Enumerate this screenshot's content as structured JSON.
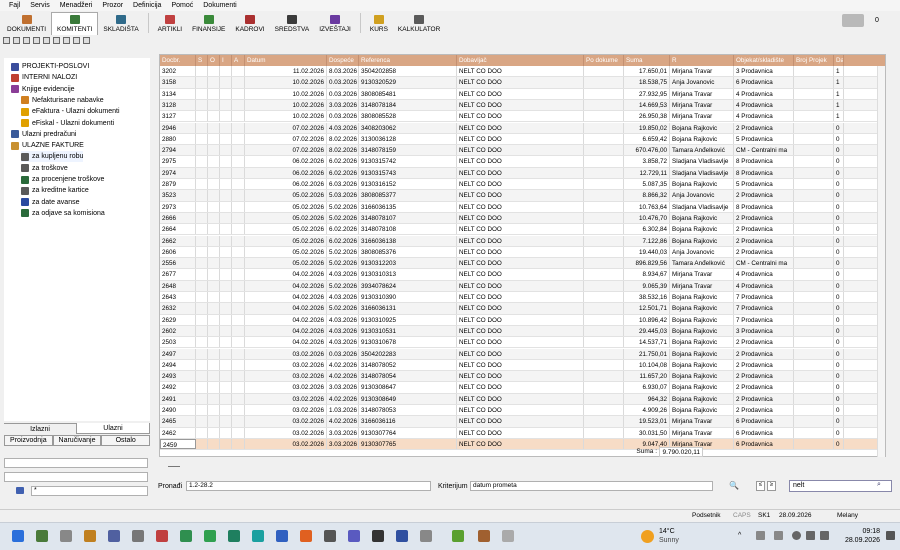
{
  "menu": [
    "Fajl",
    "Servis",
    "Menadžeri",
    "Prozor",
    "Definicija",
    "Pomoć",
    "Dokumenti"
  ],
  "toolbar": [
    "DOKUMENTI",
    "KOMITENTI",
    "SKLADIŠTA",
    "ARTIKLI",
    "FINANSIJE",
    "KADROVI",
    "SREDSTVA",
    "IZVEŠTAJI",
    "KURS",
    "KALKULATOR"
  ],
  "notification_count": "0",
  "tree": [
    {
      "label": "PROJEKTI-POSLOVI",
      "indent": 0,
      "icon": "projects-icon",
      "color": "#3a4d9c"
    },
    {
      "label": "INTERNI NALOZI",
      "indent": 0,
      "icon": "orders-icon",
      "color": "#c04030"
    },
    {
      "label": "Knjige evidencije",
      "indent": 0,
      "icon": "books-icon",
      "color": "#8a3d96"
    },
    {
      "label": "Nefakturisane nabavke",
      "indent": 1,
      "icon": "document-icon",
      "color": "#d08020"
    },
    {
      "label": "eFaktura - Ulazni dokumenti",
      "indent": 1,
      "icon": "efaktura-icon",
      "color": "#e0a000"
    },
    {
      "label": "eFiskal - Ulazni dokumenti",
      "indent": 1,
      "icon": "efiskal-icon",
      "color": "#e0a000"
    },
    {
      "label": "Ulazni predračuni",
      "indent": 0,
      "icon": "invoice-icon",
      "color": "#3a5a9a"
    },
    {
      "label": "ULAZNE FAKTURE",
      "indent": 0,
      "icon": "folder-icon",
      "color": "#c89030"
    },
    {
      "label": "za kupljenu robu",
      "indent": 1,
      "icon": "goods-icon",
      "color": "#5a5a5a"
    },
    {
      "label": "za troškove",
      "indent": 1,
      "icon": "costs-icon",
      "color": "#5a5a5a"
    },
    {
      "label": "za procenjene troškove",
      "indent": 1,
      "icon": "estimate-icon",
      "color": "#2a6a3a"
    },
    {
      "label": "za kreditne kartice",
      "indent": 1,
      "icon": "card-icon",
      "color": "#5a5a5a"
    },
    {
      "label": "za date avanse",
      "indent": 1,
      "icon": "advance-icon",
      "color": "#2a4aa0"
    },
    {
      "label": "za odjave sa komisiona",
      "indent": 1,
      "icon": "consign-icon",
      "color": "#2a6a3a"
    }
  ],
  "tabs_top": [
    "Izlazni",
    "Ulazni"
  ],
  "tabs_bottom": [
    "Proizvodnja",
    "Naručivanje",
    "Ostalo"
  ],
  "left_combo3_value": "*",
  "columns": [
    "Docbr.",
    "S",
    "O",
    "I",
    "A",
    "Datum",
    "Dospeće",
    "Referenca",
    "Dobavljač",
    "Po dokume",
    "Suma",
    "R",
    "Objekat/skladište",
    "Broj Projek",
    "Dat"
  ],
  "rows": [
    [
      "3202",
      "11.02.2026",
      "8.03.2026",
      "3504202858",
      "NELT CO DOO",
      "17.650,01",
      "Mirjana Travar",
      "3 Prodavnica",
      "1"
    ],
    [
      "3158",
      "10.02.2026",
      "0.03.2026",
      "9130320529",
      "NELT CO DOO",
      "18.538,75",
      "Anja Jovanovic",
      "6 Prodavnica",
      "1"
    ],
    [
      "3134",
      "10.02.2026",
      "0.03.2026",
      "3808085481",
      "NELT CO DOO",
      "27.932,95",
      "Mirjana Travar",
      "4 Prodavnica",
      "1"
    ],
    [
      "3128",
      "10.02.2026",
      "3.03.2026",
      "3148078184",
      "NELT CO DOO",
      "14.669,53",
      "Mirjana Travar",
      "4 Prodavnica",
      "1"
    ],
    [
      "3127",
      "10.02.2026",
      "0.03.2026",
      "3808085528",
      "NELT CO DOO",
      "26.950,38",
      "Mirjana Travar",
      "4 Prodavnica",
      "1"
    ],
    [
      "2946",
      "07.02.2026",
      "4.03.2026",
      "3408203062",
      "NELT CO DOO",
      "19.850,02",
      "Bojana Rajkovic",
      "2 Prodavnica",
      "0"
    ],
    [
      "2880",
      "07.02.2026",
      "8.02.2026",
      "3130036128",
      "NELT CO DOO",
      "6.659,42",
      "Bojana Rajkovic",
      "5 Prodavnica",
      "0"
    ],
    [
      "2794",
      "07.02.2026",
      "8.02.2026",
      "3148078159",
      "NELT CO DOO",
      "670.476,00",
      "Tamara Anđelković",
      "CM - Centralni ma",
      "0"
    ],
    [
      "2975",
      "06.02.2026",
      "6.02.2026",
      "9130315742",
      "NELT CO DOO",
      "3.858,72",
      "Sladjana Vladisavlje",
      "8 Prodavnica",
      "0"
    ],
    [
      "2974",
      "06.02.2026",
      "6.02.2026",
      "9130315743",
      "NELT CO DOO",
      "12.729,11",
      "Sladjana Vladisavlje",
      "8 Prodavnica",
      "0"
    ],
    [
      "2879",
      "06.02.2026",
      "6.03.2026",
      "9130316152",
      "NELT CO DOO",
      "5.087,35",
      "Bojana Rajkovic",
      "5 Prodavnica",
      "0"
    ],
    [
      "3523",
      "05.02.2026",
      "5.03.2026",
      "3808085377",
      "NELT CO DOO",
      "8.866,32",
      "Anja Jovanovic",
      "2 Prodavnica",
      "0"
    ],
    [
      "2973",
      "05.02.2026",
      "5.02.2026",
      "3166036135",
      "NELT CO DOO",
      "10.763,64",
      "Sladjana Vladisavlje",
      "8 Prodavnica",
      "0"
    ],
    [
      "2666",
      "05.02.2026",
      "5.02.2026",
      "3148078107",
      "NELT CO DOO",
      "10.476,70",
      "Bojana Rajkovic",
      "2 Prodavnica",
      "0"
    ],
    [
      "2664",
      "05.02.2026",
      "6.02.2026",
      "3148078108",
      "NELT CO DOO",
      "6.302,84",
      "Bojana Rajkovic",
      "2 Prodavnica",
      "0"
    ],
    [
      "2662",
      "05.02.2026",
      "6.02.2026",
      "3166036138",
      "NELT CO DOO",
      "7.122,86",
      "Bojana Rajkovic",
      "2 Prodavnica",
      "0"
    ],
    [
      "2606",
      "05.02.2026",
      "5.02.2026",
      "3808085376",
      "NELT CO DOO",
      "19.440,03",
      "Anja Jovanovic",
      "2 Prodavnica",
      "0"
    ],
    [
      "2556",
      "05.02.2026",
      "5.02.2026",
      "9130312203",
      "NELT CO DOO",
      "896.829,56",
      "Tamara Anđelković",
      "CM - Centralni ma",
      "0"
    ],
    [
      "2677",
      "04.02.2026",
      "4.03.2026",
      "9130310313",
      "NELT CO DOO",
      "8.934,67",
      "Mirjana Travar",
      "4 Prodavnica",
      "0"
    ],
    [
      "2648",
      "04.02.2026",
      "5.02.2026",
      "3934078624",
      "NELT CO DOO",
      "9.065,39",
      "Mirjana Travar",
      "4 Prodavnica",
      "0"
    ],
    [
      "2643",
      "04.02.2026",
      "4.03.2026",
      "9130310390",
      "NELT CO DOO",
      "38.532,16",
      "Bojana Rajkovic",
      "7 Prodavnica",
      "0"
    ],
    [
      "2632",
      "04.02.2026",
      "5.02.2026",
      "3166036131",
      "NELT CO DOO",
      "12.501,71",
      "Bojana Rajkovic",
      "7 Prodavnica",
      "0"
    ],
    [
      "2629",
      "04.02.2026",
      "4.03.2026",
      "9130310925",
      "NELT CO DOO",
      "10.896,42",
      "Bojana Rajkovic",
      "7 Prodavnica",
      "0"
    ],
    [
      "2602",
      "04.02.2026",
      "4.03.2026",
      "9130310531",
      "NELT CO DOO",
      "29.445,03",
      "Bojana Rajkovic",
      "3 Prodavnica",
      "0"
    ],
    [
      "2503",
      "04.02.2026",
      "4.03.2026",
      "9130310678",
      "NELT CO DOO",
      "14.537,71",
      "Bojana Rajkovic",
      "2 Prodavnica",
      "0"
    ],
    [
      "2497",
      "03.02.2026",
      "0.03.2026",
      "3504202283",
      "NELT CO DOO",
      "21.750,01",
      "Bojana Rajkovic",
      "2 Prodavnica",
      "0"
    ],
    [
      "2494",
      "03.02.2026",
      "4.02.2026",
      "3148078052",
      "NELT CO DOO",
      "10.104,08",
      "Bojana Rajkovic",
      "2 Prodavnica",
      "0"
    ],
    [
      "2493",
      "03.02.2026",
      "4.02.2026",
      "3148078054",
      "NELT CO DOO",
      "11.657,20",
      "Bojana Rajkovic",
      "2 Prodavnica",
      "0"
    ],
    [
      "2492",
      "03.02.2026",
      "3.03.2026",
      "9130308647",
      "NELT CO DOO",
      "6.930,07",
      "Bojana Rajkovic",
      "2 Prodavnica",
      "0"
    ],
    [
      "2491",
      "03.02.2026",
      "4.02.2026",
      "9130308649",
      "NELT CO DOO",
      "964,32",
      "Bojana Rajkovic",
      "2 Prodavnica",
      "0"
    ],
    [
      "2490",
      "03.02.2026",
      "1.03.2026",
      "3148078053",
      "NELT CO DOO",
      "4.909,26",
      "Bojana Rajkovic",
      "2 Prodavnica",
      "0"
    ],
    [
      "2465",
      "03.02.2026",
      "4.02.2026",
      "3166036116",
      "NELT CO DOO",
      "19.523,01",
      "Mirjana Travar",
      "6 Prodavnica",
      "0"
    ],
    [
      "2462",
      "03.02.2026",
      "3.03.2026",
      "9130307764",
      "NELT CO DOO",
      "30.031,50",
      "Mirjana Travar",
      "6 Prodavnica",
      "0"
    ],
    [
      "2459",
      "03.02.2026",
      "3.03.2026",
      "9130307765",
      "NELT CO DOO",
      "9.047,40",
      "Mirjana Travar",
      "6 Prodavnica",
      "0"
    ]
  ],
  "sum_label": "Suma :",
  "sum_value": "9.790.020,11",
  "find": {
    "label": "Pronađi",
    "value": "1.2-28.2",
    "criterion_label": "Kriterijum",
    "criterion_value": "datum prometa",
    "search_value": "nelt"
  },
  "status": {
    "user": "Podsetnik",
    "caps": "CAPS",
    "sk": "SK1",
    "date": "28.09.2026",
    "name": "Melany"
  },
  "taskbar": {
    "temp": "14°C",
    "weather": "Sunny",
    "time": "09:18",
    "date": "28.09.2026"
  }
}
